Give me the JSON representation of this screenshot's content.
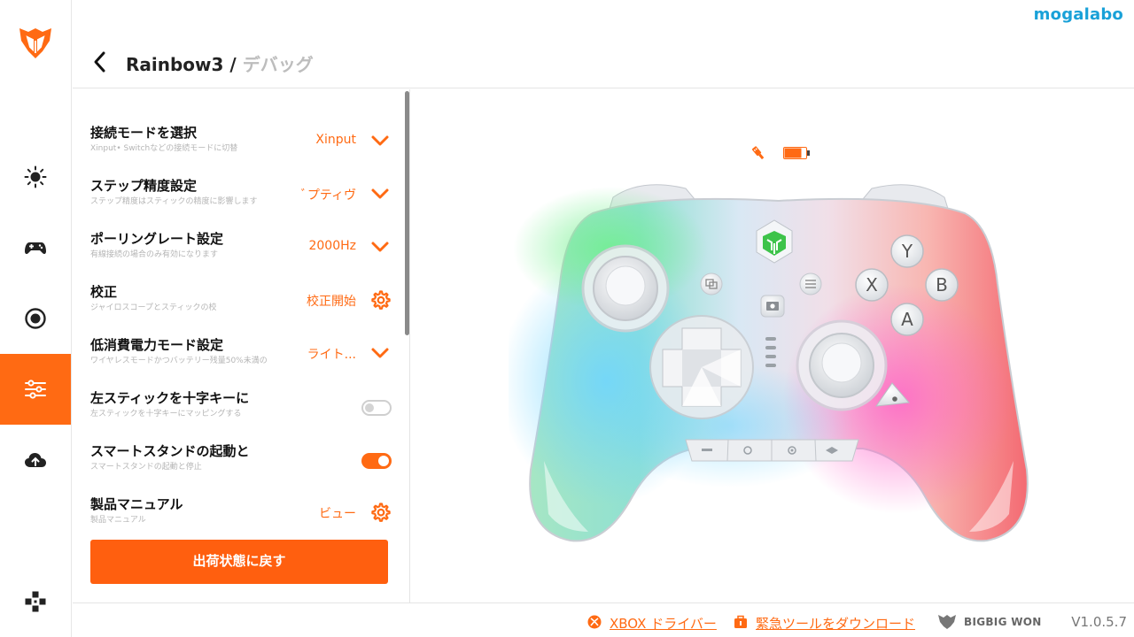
{
  "brand": "mogalabo",
  "breadcrumb": {
    "device": "Rainbow3",
    "separator": "/",
    "page": "デバッグ"
  },
  "sidebar": {
    "items": [
      {
        "icon": "brightness-icon",
        "label": ""
      },
      {
        "icon": "gamepad-icon",
        "label": ""
      },
      {
        "icon": "record-icon",
        "label": ""
      },
      {
        "icon": "sliders-icon",
        "label": "",
        "active": true
      },
      {
        "icon": "cloud-upload-icon",
        "label": ""
      },
      {
        "icon": "dpad-icon",
        "label": ""
      }
    ]
  },
  "settings": {
    "rows": [
      {
        "title": "接続モードを選択",
        "sub": "Xinput• Switchなどの接続モードに切替",
        "value": "Xinput",
        "control": "chevron-down-icon"
      },
      {
        "title": "ステップ精度設定",
        "sub": "ステップ精度はスティックの精度に影響します",
        "value": "ﾞプティヴ",
        "control": "chevron-down-icon"
      },
      {
        "title": "ポーリングレート設定",
        "sub": "有線接続の場合のみ有効になります",
        "value": "2000Hz",
        "control": "chevron-down-icon"
      },
      {
        "title": "校正",
        "sub": "ジャイロスコープとスティックの校",
        "value": "校正開始",
        "control": "gear-icon"
      },
      {
        "title": "低消費電力モード設定",
        "sub": "ワイヤレスモードかつバッテリー残量50%未満の",
        "value": "ライト...",
        "control": "chevron-down-icon"
      },
      {
        "title": "左スティックを十字キーに",
        "sub": "左スティックを十字キーにマッピングする",
        "value": "",
        "control": "toggle",
        "state": false
      },
      {
        "title": "スマートスタンドの起動と",
        "sub": "スマートスタンドの起動と停止",
        "value": "",
        "control": "toggle",
        "state": true
      },
      {
        "title": "製品マニュアル",
        "sub": "製品マニュアル",
        "value": "ビュー",
        "control": "gear-icon"
      }
    ],
    "reset_label": "出荷状態に戻す"
  },
  "footer": {
    "xbox_driver": "XBOX ドライバー",
    "emergency_tool": "緊急ツールをダウンロード",
    "vendor": "BIGBIG WON",
    "version": "V1.0.5.7"
  },
  "controller": {
    "face_buttons": [
      "Y",
      "X",
      "B",
      "A"
    ],
    "battery_level": 0.8,
    "connection": "usb"
  },
  "colors": {
    "accent": "#ff6a13",
    "brand": "#19a1d8"
  }
}
